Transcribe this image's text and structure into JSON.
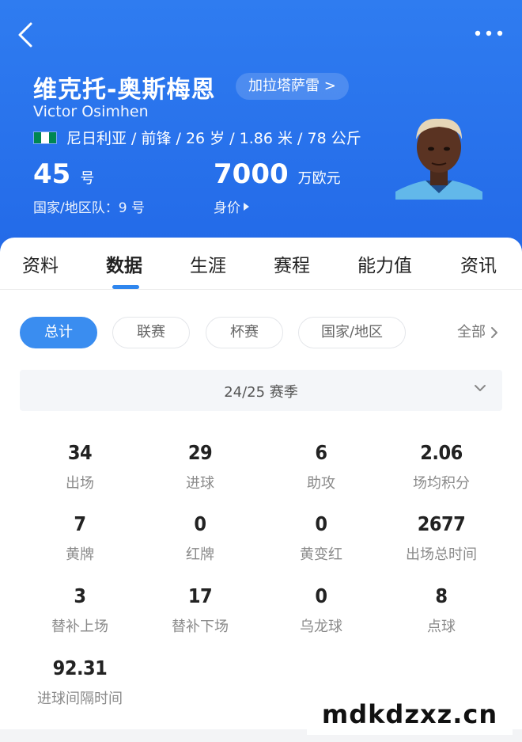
{
  "header": {
    "name_cn": "维克托-奥斯梅恩",
    "club_label": "加拉塔萨雷 >",
    "name_en": "Victor Osimhen",
    "bio": "尼日利亚 / 前锋 / 26 岁 / 1.86 米 / 78 公斤",
    "flag_colors": [
      "#008751",
      "#ffffff",
      "#008751"
    ],
    "shirt_number": "45",
    "shirt_unit": "号",
    "national_team": "国家/地区队：9 号",
    "market_value": "7000",
    "market_value_unit": "万欧元",
    "market_value_label": "身价",
    "back_icon": "chevron-left-icon",
    "more_icon": "more-dots-icon"
  },
  "tabs": [
    "资料",
    "数据",
    "生涯",
    "赛程",
    "能力值",
    "资讯"
  ],
  "active_tab": "数据",
  "filters": {
    "chips": [
      "总计",
      "联赛",
      "杯赛",
      "国家/地区"
    ],
    "active": "总计",
    "all_label": "全部"
  },
  "season": "24/25 赛季",
  "stats": [
    {
      "value": "34",
      "label": "出场"
    },
    {
      "value": "29",
      "label": "进球"
    },
    {
      "value": "6",
      "label": "助攻"
    },
    {
      "value": "2.06",
      "label": "场均积分"
    },
    {
      "value": "7",
      "label": "黄牌"
    },
    {
      "value": "0",
      "label": "红牌"
    },
    {
      "value": "0",
      "label": "黄变红"
    },
    {
      "value": "2677",
      "label": "出场总时间"
    },
    {
      "value": "3",
      "label": "替补上场"
    },
    {
      "value": "17",
      "label": "替补下场"
    },
    {
      "value": "0",
      "label": "乌龙球"
    },
    {
      "value": "8",
      "label": "点球"
    },
    {
      "value": "92.31",
      "label": "进球间隔时间"
    }
  ],
  "watermark": "mdkdzxz.cn",
  "colors": {
    "header_blue": "#2a74ec",
    "accent": "#3a8df0"
  }
}
